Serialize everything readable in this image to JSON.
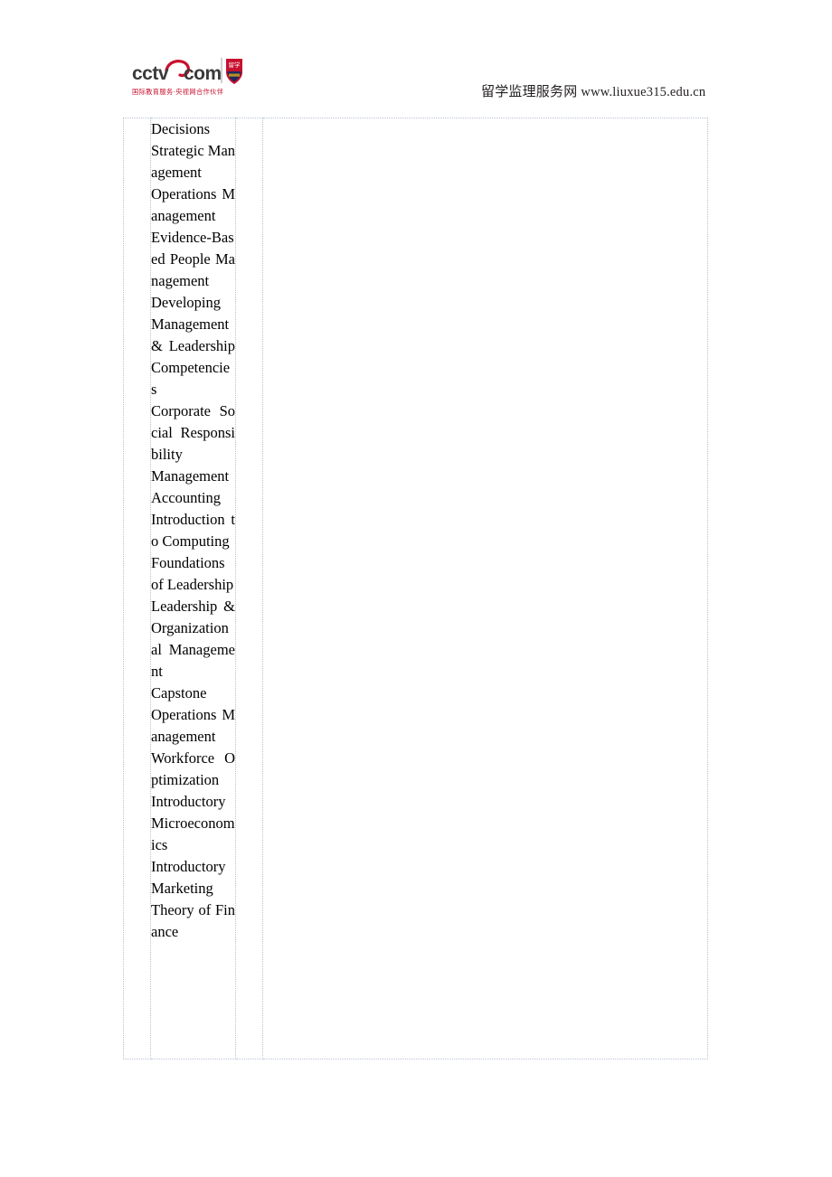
{
  "header": {
    "logo": {
      "name": "cctv-com-logo",
      "wordmark": "cctv.com",
      "tagline_cn": "国际教育服务·央视网合作伙伴",
      "badge_top_cn": "留学",
      "badge_colors": {
        "red": "#c8102e",
        "navy": "#1b2a5e",
        "dark_text": "#3a3a3a",
        "tagline_red": "#c8102e"
      }
    },
    "site_name_cn": "留学监理服务网",
    "site_url": "www.liuxue315.edu.cn"
  },
  "table": {
    "columns": 4,
    "course_column_index": 1,
    "courses": [
      {
        "text": "Decisions",
        "justify_all": false
      },
      {
        "text": "Strategic Management",
        "justify_all": false
      },
      {
        "text": "Operations Management",
        "justify_all": false
      },
      {
        "text": "Evidence-Based People Management",
        "justify_all": false
      },
      {
        "text": "Developing Management & Leadership Competencies",
        "justify_all": false
      },
      {
        "text": "Corporate Social Responsibility",
        "justify_all": false
      },
      {
        "text": "Management Accounting",
        "justify_all": false
      },
      {
        "text": "Introduction to Computing",
        "justify_all": false
      },
      {
        "text": "Foundations of Leadership",
        "justify_all": false
      },
      {
        "text": "Leadership & Organizational Management",
        "justify_all": false
      },
      {
        "text": "Capstone",
        "justify_all": false
      },
      {
        "text": "Operations Management",
        "justify_all": false
      },
      {
        "text": "Workforce Optimization",
        "justify_all": false
      },
      {
        "text": "Introductory Microeconomics",
        "justify_all": false
      },
      {
        "text": "Introductory Marketing",
        "justify_all": false
      },
      {
        "text": "Theory of Finance",
        "justify_all": true
      }
    ]
  }
}
